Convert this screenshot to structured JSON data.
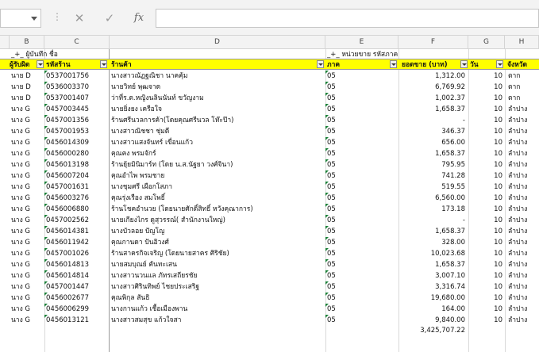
{
  "formula_bar": {
    "fx_label": "fx",
    "cancel_glyph": "✕",
    "enter_glyph": "✓",
    "input_value": ""
  },
  "columns": [
    "B",
    "C",
    "D",
    "E",
    "F",
    "G",
    "H"
  ],
  "group_row": {
    "b_label": "_+_ ผู้บันทึก ชื่อ",
    "e_label": "_+_ หน่วยขาย รหัสภาค"
  },
  "headers": {
    "b": "ผู้รับผิด",
    "c": "รหัสร้าน",
    "d": "ร้านค้า",
    "e": "ภาค",
    "f": "ยอดขาย (บาท)",
    "g": "วัน",
    "h": "จังหวัด"
  },
  "rows": [
    {
      "b": "นาย D",
      "c": "0537001756",
      "d": "นางสาวณัฏฐณิชา นาคคุ้ม",
      "e": "05",
      "f": "1,312.00",
      "g": "10",
      "h": "ตาก"
    },
    {
      "b": "นาย D",
      "c": "0536003370",
      "d": "นายวิทย์ พุฒจาด",
      "e": "05",
      "f": "6,769.92",
      "g": "10",
      "h": "ตาก"
    },
    {
      "b": "นาย D",
      "c": "0537001407",
      "d": "ว่าที่ร.ต.หญิงนลินนันท์ ขวัญงาม",
      "e": "05",
      "f": "1,002.37",
      "g": "10",
      "h": "ตาก"
    },
    {
      "b": "นาง G",
      "c": "0457003445",
      "d": "นายยิ่งยง เครือใจ",
      "e": "05",
      "f": "1,658.37",
      "g": "10",
      "h": "ลำปาง"
    },
    {
      "b": "นาง G",
      "c": "0457001356",
      "d": "ร้านศรีนวลการค้า(โดยคุณศรีนวล โท๊ะป๊า)",
      "e": "05",
      "f": "-",
      "g": "10",
      "h": "ลำปาง"
    },
    {
      "b": "นาง G",
      "c": "0457001953",
      "d": "นางสาวณิชชา ชุ่มดี",
      "e": "05",
      "f": "346.37",
      "g": "10",
      "h": "ลำปาง"
    },
    {
      "b": "นาง G",
      "c": "0456014309",
      "d": "นางสาวแสงจันทร์ เขื่อนแก้ว",
      "e": "05",
      "f": "656.00",
      "g": "10",
      "h": "ลำปาง"
    },
    {
      "b": "นาง G",
      "c": "0456000280",
      "d": "คุณคง พรมจักร์",
      "e": "05",
      "f": "1,658.37",
      "g": "10",
      "h": "ลำปาง"
    },
    {
      "b": "นาง G",
      "c": "0456013198",
      "d": "ร้านยุ้ยมินิมาร์ท (โดย น.ส.นัฐยา วงศ์จินา)",
      "e": "05",
      "f": "795.95",
      "g": "10",
      "h": "ลำปาง"
    },
    {
      "b": "นาง G",
      "c": "0456007204",
      "d": "คุณอำไพ พรมชาย",
      "e": "05",
      "f": "741.28",
      "g": "10",
      "h": "ลำปาง"
    },
    {
      "b": "นาง G",
      "c": "0457001631",
      "d": "นางชุมศรี เผือกโสภา",
      "e": "05",
      "f": "519.55",
      "g": "10",
      "h": "ลำปาง"
    },
    {
      "b": "นาง G",
      "c": "0456003276",
      "d": "คุณรุ่งเรือง สมโพธิ์",
      "e": "05",
      "f": "6,560.00",
      "g": "10",
      "h": "ลำปาง"
    },
    {
      "b": "นาง G",
      "c": "0456006880",
      "d": "ร้านโชคอำนวย (โดยนายศักดิ์สิทธิ์ หวังคุณาการ)",
      "e": "05",
      "f": "173.18",
      "g": "10",
      "h": "ลำปาง"
    },
    {
      "b": "นาง G",
      "c": "0457002562",
      "d": "นายเกียงไกร ดูสุวรรณ์( สำนักงานใหญ่)",
      "e": "05",
      "f": "-",
      "g": "10",
      "h": "ลำปาง"
    },
    {
      "b": "นาง G",
      "c": "0456014381",
      "d": "นางบัวลอย ปัญโญ",
      "e": "05",
      "f": "1,658.37",
      "g": "10",
      "h": "ลำปาง"
    },
    {
      "b": "นาง G",
      "c": "0456011942",
      "d": "คุณกานดา ปันอิวงศ์",
      "e": "05",
      "f": "328.00",
      "g": "10",
      "h": "ลำปาง"
    },
    {
      "b": "นาง G",
      "c": "0457001026",
      "d": "ร้านสาครกิจเจริญ (โดยนายสาคร ศิริชัย)",
      "e": "05",
      "f": "10,023.68",
      "g": "10",
      "h": "ลำปาง"
    },
    {
      "b": "นาง G",
      "c": "0456014813",
      "d": "นายสมบุณย์ คันทะเสน",
      "e": "05",
      "f": "1,658.37",
      "g": "10",
      "h": "ลำปาง"
    },
    {
      "b": "นาง G",
      "c": "0456014814",
      "d": "นางสาวนวนแล ภัทรเสถียรชัย",
      "e": "05",
      "f": "3,007.10",
      "g": "10",
      "h": "ลำปาง"
    },
    {
      "b": "นาง G",
      "c": "0457001447",
      "d": "นางสาวศิรินทิพย์ ไชยประเสริฐ",
      "e": "05",
      "f": "3,316.74",
      "g": "10",
      "h": "ลำปาง"
    },
    {
      "b": "นาง G",
      "c": "0456002677",
      "d": "คุณพิกุล สันธิ",
      "e": "05",
      "f": "19,680.00",
      "g": "10",
      "h": "ลำปาง"
    },
    {
      "b": "นาง G",
      "c": "0456006299",
      "d": "นางกานแก้ว เชื้อเมืองพาน",
      "e": "05",
      "f": "164.00",
      "g": "10",
      "h": "ลำปาง"
    },
    {
      "b": "นาง G",
      "c": "0456013121",
      "d": "นางสาวสมสุข แก้วใจสา",
      "e": "05",
      "f": "9,840.00",
      "g": "10",
      "h": "ลำปาง"
    }
  ],
  "total": "3,425,707.22",
  "colors": {
    "header_fill": "#ffff00",
    "header_text": "#d40000",
    "error_marker": "#1a7f37"
  }
}
